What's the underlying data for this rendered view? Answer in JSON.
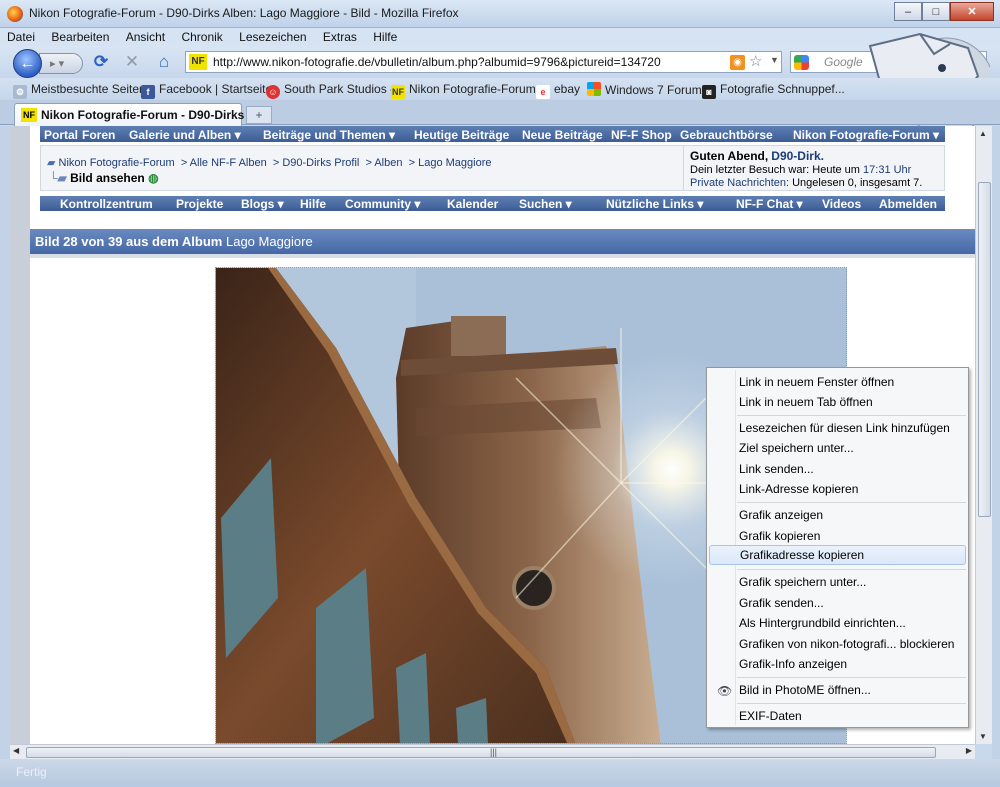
{
  "window": {
    "title": "Nikon Fotografie-Forum - D90-Dirks Alben: Lago Maggiore - Bild - Mozilla Firefox",
    "minimize": "–",
    "maximize": "□",
    "close": "✕"
  },
  "menu": [
    "Datei",
    "Bearbeiten",
    "Ansicht",
    "Chronik",
    "Lesezeichen",
    "Extras",
    "Hilfe"
  ],
  "nav": {
    "url": "http://www.nikon-fotografie.de/vbulletin/album.php?albumid=9796&pictureid=134720",
    "site_badge": "NF",
    "search_placeholder": "Google"
  },
  "bookmarks": [
    {
      "label": "Meistbesuchte Seiten",
      "icon": "gear-icon"
    },
    {
      "label": "Facebook | Startseite",
      "icon": "facebook-icon"
    },
    {
      "label": "South Park Studios -",
      "icon": "southpark-icon"
    },
    {
      "label": "Nikon Fotografie-Forum",
      "icon": "nf-icon"
    },
    {
      "label": "ebay",
      "icon": "ebay-icon"
    },
    {
      "label": "Windows 7 Forum",
      "icon": "windows-icon"
    },
    {
      "label": "Fotografie Schnuppef...",
      "icon": "camera-icon"
    }
  ],
  "tab": {
    "title": "Nikon Fotografie-Forum - D90-Dirks ...",
    "badge": "NF",
    "new_tab": "+"
  },
  "forum_nav": [
    "Portal",
    "Foren",
    "Galerie und Alben ▾",
    "Beiträge und Themen ▾",
    "Heutige Beiträge",
    "Neue Beiträge",
    "NF-F Shop",
    "Gebrauchtbörse",
    "Nikon Fotografie-Forum ▾"
  ],
  "breadcrumb": {
    "items": [
      "Nikon Fotografie-Forum",
      "> Alle NF-F Alben",
      "> D90-Dirks Profil",
      "> Alben",
      "> Lago Maggiore"
    ],
    "current": "Bild ansehen"
  },
  "user_box": {
    "greeting": "Guten Abend,",
    "username": "D90-Dirk.",
    "last_visit": "Dein letzter Besuch war: Heute um",
    "last_visit_time": "17:31 Uhr",
    "pm_label": "Private Nachrichten:",
    "pm_text": "Ungelesen 0, insgesamt 7."
  },
  "sub_nav": [
    "Kontrollzentrum",
    "Projekte",
    "Blogs ▾",
    "Hilfe",
    "Community ▾",
    "Kalender",
    "Suchen ▾",
    "Nützliche Links ▾",
    "NF-F Chat ▾",
    "Videos",
    "Abmelden"
  ],
  "album": {
    "heading": "Bild 28 von 39 aus dem Album",
    "name": "Lago Maggiore"
  },
  "context_menu": {
    "groups": [
      [
        "Link in neuem Fenster öffnen",
        "Link in neuem Tab öffnen"
      ],
      [
        "Lesezeichen für diesen Link hinzufügen",
        "Ziel speichern unter...",
        "Link senden...",
        "Link-Adresse kopieren"
      ],
      [
        "Grafik anzeigen",
        "Grafik kopieren",
        "Grafikadresse kopieren"
      ],
      [
        "Grafik speichern unter...",
        "Grafik senden...",
        "Als Hintergrundbild einrichten...",
        "Grafiken von nikon-fotografi... blockieren",
        "Grafik-Info anzeigen"
      ],
      [
        "Bild in PhotoME öffnen..."
      ],
      [
        "EXIF-Daten"
      ]
    ],
    "highlighted": "Grafikadresse kopieren"
  },
  "status": {
    "text": "Fertig"
  }
}
